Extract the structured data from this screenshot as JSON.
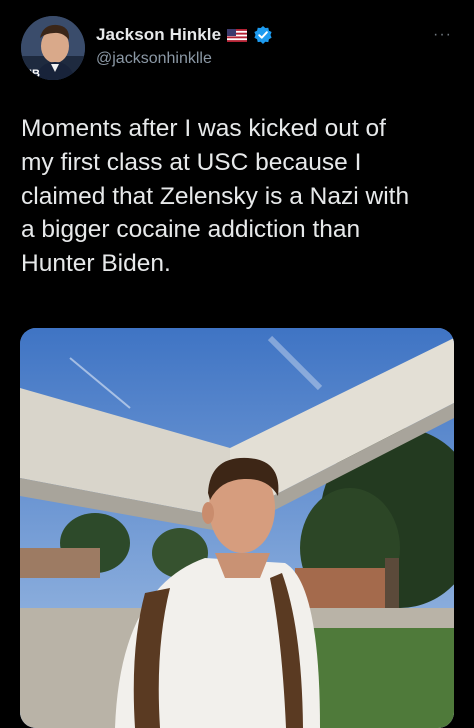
{
  "author": {
    "display_name": "Jackson Hinkle",
    "handle": "@jacksonhinklle",
    "avatar_initials": "HB",
    "badges": [
      "us-flag-icon",
      "verified-badge-icon"
    ]
  },
  "menu": {
    "more_label": "···"
  },
  "tweet": {
    "text": "Moments after I was kicked out of\nmy first class at USC because I\nclaimed that Zelensky is a Nazi with\na bigger cocaine addiction than\nHunter Biden."
  },
  "colors": {
    "background": "#000000",
    "text_primary": "#e7e9ea",
    "text_secondary": "#8b98a5",
    "verified": "#1d9bf0"
  }
}
